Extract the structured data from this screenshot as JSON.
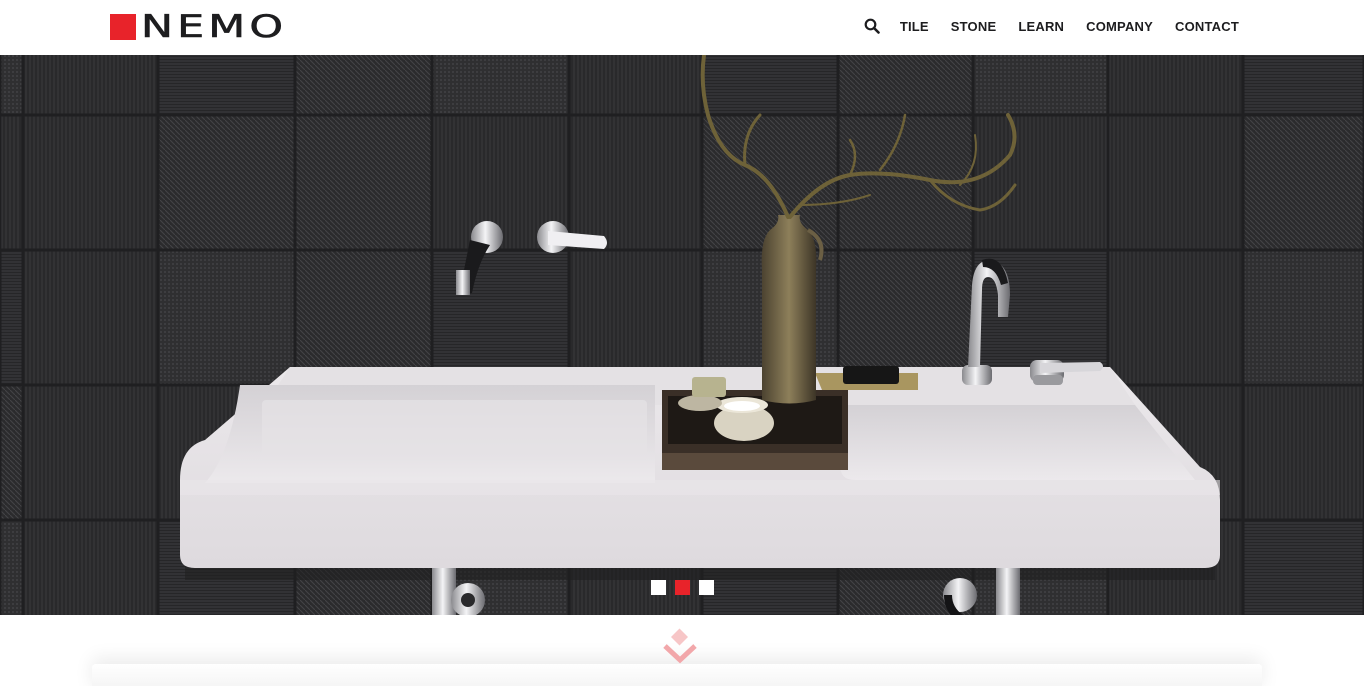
{
  "brand": {
    "name": "NEMO",
    "accent_color": "#e8232a",
    "text_color": "#1d1d1f"
  },
  "header": {
    "search_icon": "search-icon",
    "nav": [
      {
        "label": "TILE"
      },
      {
        "label": "STONE"
      },
      {
        "label": "LEARN"
      },
      {
        "label": "COMPANY"
      },
      {
        "label": "CONTACT"
      }
    ]
  },
  "hero": {
    "image_description_icon": "bathroom-sink-photo",
    "slides": [
      {
        "active": false
      },
      {
        "active": true
      },
      {
        "active": false
      }
    ],
    "scroll_icon": "chevron-down-icon"
  }
}
